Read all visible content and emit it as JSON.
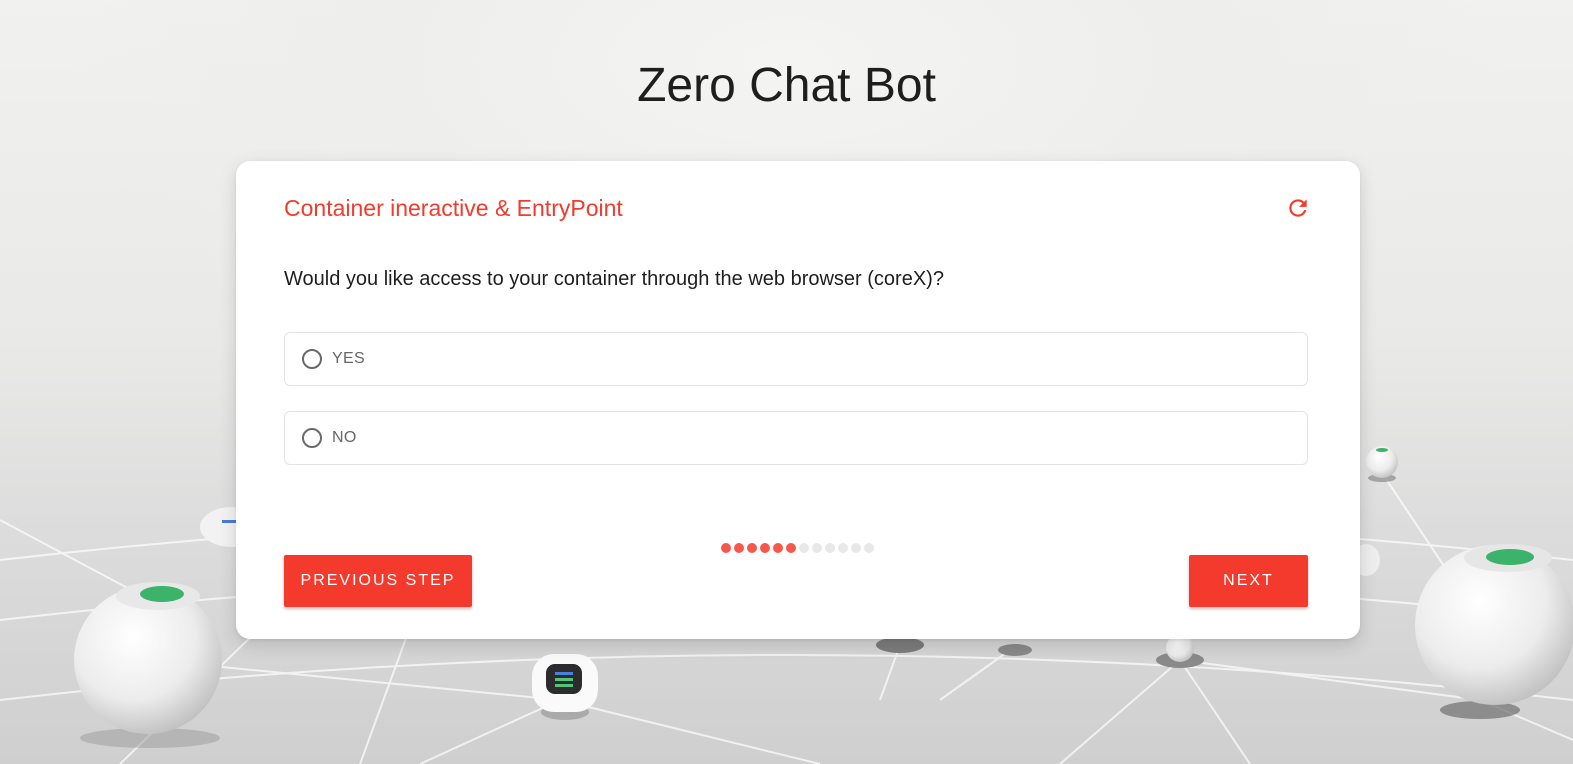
{
  "page": {
    "title": "Zero Chat Bot"
  },
  "card": {
    "heading": "Container ineractive & EntryPoint",
    "question": "Would you like access to your container through the web browser (coreX)?",
    "options": [
      {
        "label": "YES",
        "selected": false
      },
      {
        "label": "NO",
        "selected": false
      }
    ],
    "progress": {
      "total": 12,
      "completed": 6
    },
    "buttons": {
      "previous_label": "PREVIOUS STEP",
      "next_label": "NEXT"
    }
  },
  "icons": {
    "refresh": "refresh-icon"
  },
  "colors": {
    "accent": "#f33a2c",
    "progress_done": "#f5584a",
    "progress_pending": "#e8e8e8",
    "text": "#1e1e1e"
  }
}
